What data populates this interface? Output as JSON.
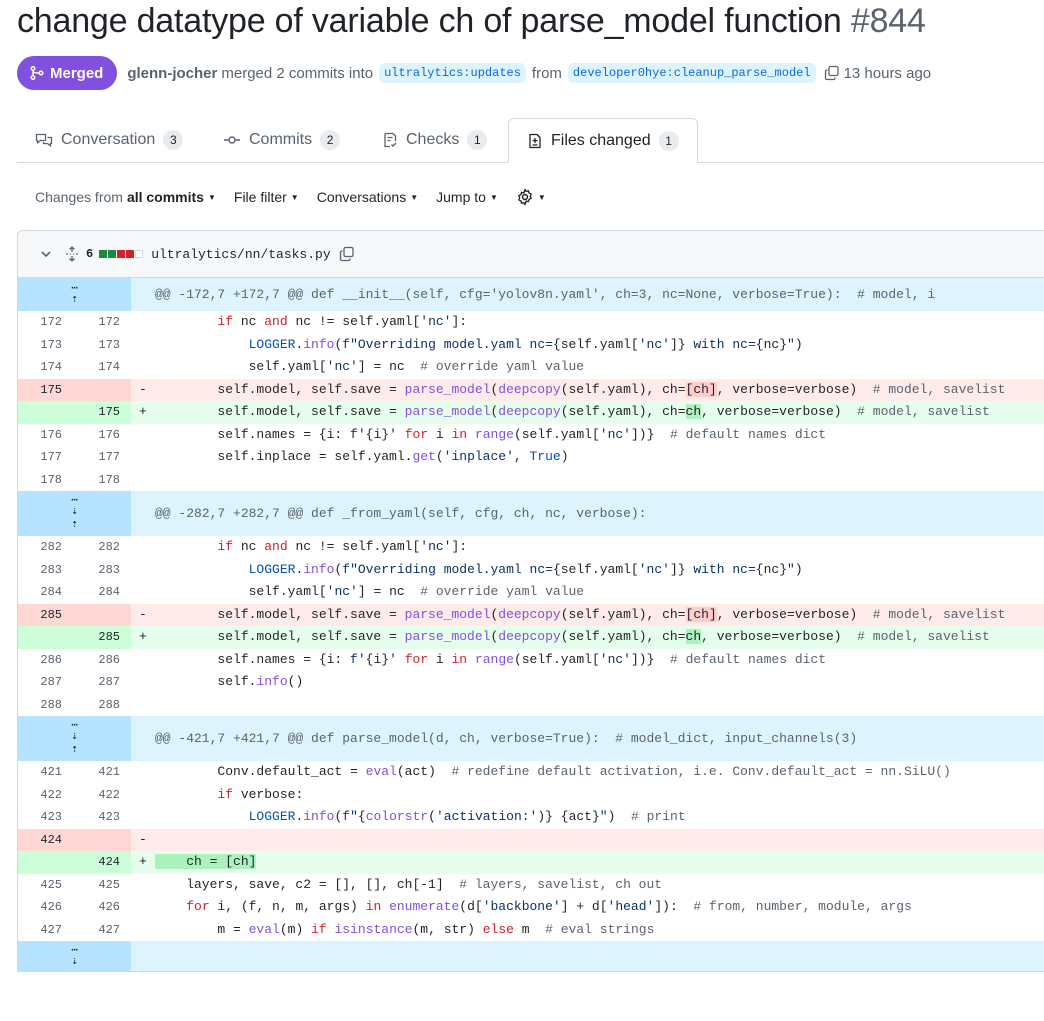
{
  "pr": {
    "title": "change datatype of variable ch of parse_model function",
    "number": "#844",
    "status": "Merged",
    "author": "glenn-jocher",
    "action": "merged 2 commits into",
    "base_branch": "ultralytics:updates",
    "from_word": "from",
    "head_branch": "developer0hye:cleanup_parse_model",
    "time": "13 hours ago",
    "accent": "#8250df"
  },
  "tabs": [
    {
      "label": "Conversation",
      "count": "3",
      "icon": "comment-discussion-icon"
    },
    {
      "label": "Commits",
      "count": "2",
      "icon": "git-commit-icon"
    },
    {
      "label": "Checks",
      "count": "1",
      "icon": "checklist-icon"
    },
    {
      "label": "Files changed",
      "count": "1",
      "icon": "file-diff-icon",
      "active": true
    }
  ],
  "toolbar": {
    "changes_prefix": "Changes from",
    "changes_value": "all commits",
    "file_filter": "File filter",
    "conversations": "Conversations",
    "jump_to": "Jump to"
  },
  "file": {
    "changes": "6",
    "path": "ultralytics/nn/tasks.py",
    "diffstat_colors": [
      "#1f883d",
      "#1f883d",
      "#cf222e",
      "#cf222e",
      "#d1d9e0"
    ]
  },
  "hunks": [
    "@@ -172,7 +172,7 @@ def __init__(self, cfg='yolov8n.yaml', ch=3, nc=None, verbose=True):  # model, i",
    "@@ -282,7 +282,7 @@ def _from_yaml(self, cfg, ch, nc, verbose):",
    "@@ -421,7 +421,7 @@ def parse_model(d, ch, verbose=True):  # model_dict, input_channels(3)"
  ],
  "lines": {
    "h1": [
      {
        "o": "172",
        "n": "172",
        "m": " ",
        "t": "normal"
      },
      {
        "o": "173",
        "n": "173",
        "m": " ",
        "t": "normal"
      },
      {
        "o": "174",
        "n": "174",
        "m": " ",
        "t": "normal"
      },
      {
        "o": "175",
        "n": "",
        "m": "-",
        "t": "del"
      },
      {
        "o": "",
        "n": "175",
        "m": "+",
        "t": "add"
      },
      {
        "o": "176",
        "n": "176",
        "m": " ",
        "t": "normal"
      },
      {
        "o": "177",
        "n": "177",
        "m": " ",
        "t": "normal"
      },
      {
        "o": "178",
        "n": "178",
        "m": " ",
        "t": "normal"
      }
    ],
    "h2": [
      {
        "o": "282",
        "n": "282",
        "m": " ",
        "t": "normal"
      },
      {
        "o": "283",
        "n": "283",
        "m": " ",
        "t": "normal"
      },
      {
        "o": "284",
        "n": "284",
        "m": " ",
        "t": "normal"
      },
      {
        "o": "285",
        "n": "",
        "m": "-",
        "t": "del"
      },
      {
        "o": "",
        "n": "285",
        "m": "+",
        "t": "add"
      },
      {
        "o": "286",
        "n": "286",
        "m": " ",
        "t": "normal"
      },
      {
        "o": "287",
        "n": "287",
        "m": " ",
        "t": "normal"
      },
      {
        "o": "288",
        "n": "288",
        "m": " ",
        "t": "normal"
      }
    ],
    "h3": [
      {
        "o": "421",
        "n": "421",
        "m": " ",
        "t": "normal"
      },
      {
        "o": "422",
        "n": "422",
        "m": " ",
        "t": "normal"
      },
      {
        "o": "423",
        "n": "423",
        "m": " ",
        "t": "normal"
      },
      {
        "o": "424",
        "n": "",
        "m": "-",
        "t": "del"
      },
      {
        "o": "",
        "n": "424",
        "m": "+",
        "t": "add"
      },
      {
        "o": "425",
        "n": "425",
        "m": " ",
        "t": "normal"
      },
      {
        "o": "426",
        "n": "426",
        "m": " ",
        "t": "normal"
      },
      {
        "o": "427",
        "n": "427",
        "m": " ",
        "t": "normal"
      }
    ]
  }
}
